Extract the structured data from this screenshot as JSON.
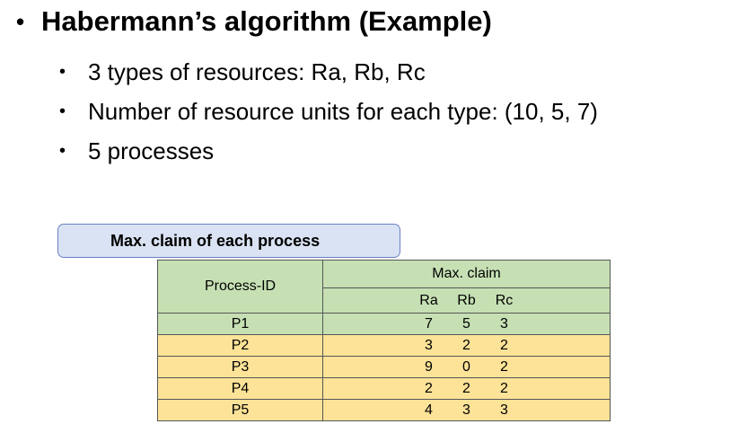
{
  "title": {
    "bullet": "•",
    "text": "Habermann’s algorithm (Example)"
  },
  "bullets": [
    {
      "dot": "•",
      "text": "3 types of resources: Ra, Rb, Rc"
    },
    {
      "dot": "•",
      "text": "Number of resource units for each type: (10, 5, 7)"
    },
    {
      "dot": "•",
      "text": "5 processes"
    }
  ],
  "caption": "Max. claim of each process",
  "table": {
    "pid_header": "Process-ID",
    "group_header": "Max. claim",
    "sub_headers": [
      "Ra",
      "Rb",
      "Rc"
    ],
    "rows": [
      {
        "pid": "P1",
        "ra": "7",
        "rb": "5",
        "rc": "3"
      },
      {
        "pid": "P2",
        "ra": "3",
        "rb": "2",
        "rc": "2"
      },
      {
        "pid": "P3",
        "ra": "9",
        "rb": "0",
        "rc": "2"
      },
      {
        "pid": "P4",
        "ra": "2",
        "rb": "2",
        "rc": "2"
      },
      {
        "pid": "P5",
        "ra": "4",
        "rb": "3",
        "rc": "3"
      }
    ]
  },
  "colors": {
    "header_green": "#c6e0b4",
    "row_yellow": "#fde398",
    "caption_fill": "#dae3f3",
    "caption_border": "#6b7fc4"
  }
}
